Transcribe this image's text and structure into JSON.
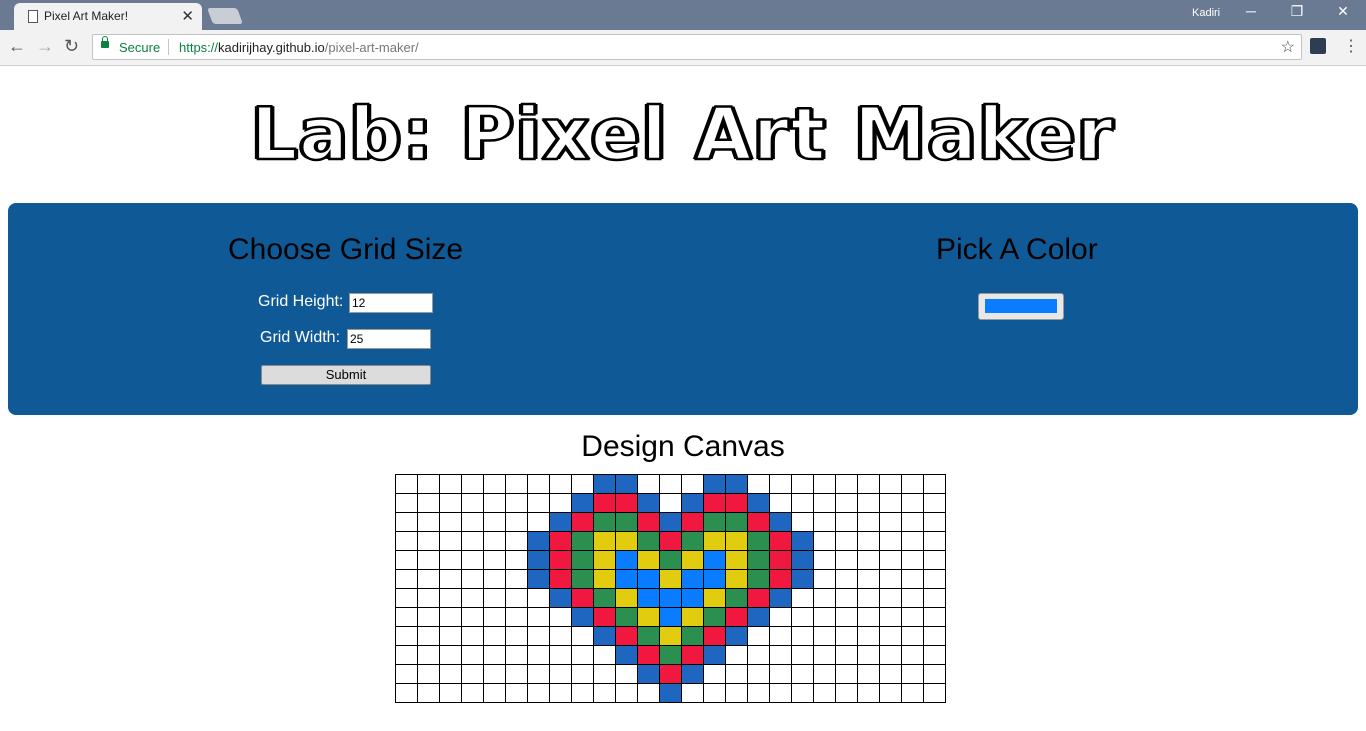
{
  "browser": {
    "tab_title": "Pixel Art Maker!",
    "tab_close": "✕",
    "user": "Kadiri",
    "url_scheme": "https://",
    "url_host": "kadirijhay.github.io",
    "url_path": "/pixel-art-maker/",
    "secure_label": "Secure"
  },
  "page": {
    "heading": "Lab: Pixel Art Maker",
    "grid_section_title": "Choose Grid Size",
    "height_label": "Grid Height:",
    "height_value": "12",
    "width_label": "Grid Width:",
    "width_value": "25",
    "submit_label": "Submit",
    "color_section_title": "Pick A Color",
    "picked_color": "#0a7cff",
    "canvas_title": "Design Canvas"
  },
  "palette": {
    "B": "#1f66c0",
    "R": "#f0183f",
    "G": "#2a8f4f",
    "Y": "#e2cc10",
    "L": "#0a7cff",
    "W": "#ffffff"
  },
  "canvas": {
    "rows": [
      ".........BB...BB.........",
      "........BRRB.BRRB........",
      ".......BRGGRBRGGRB.......",
      "......BRGYYGRGYYGRB......",
      "......BRGYLYGYLYGRB......",
      "......BRGYLLYLLYGRB......",
      ".......BRGYLLLYGRB.......",
      "........BRGYLYGRB........",
      ".........BRGYGRB.........",
      "..........BRGRB..........",
      "...........BRB...........",
      "............B............"
    ]
  }
}
